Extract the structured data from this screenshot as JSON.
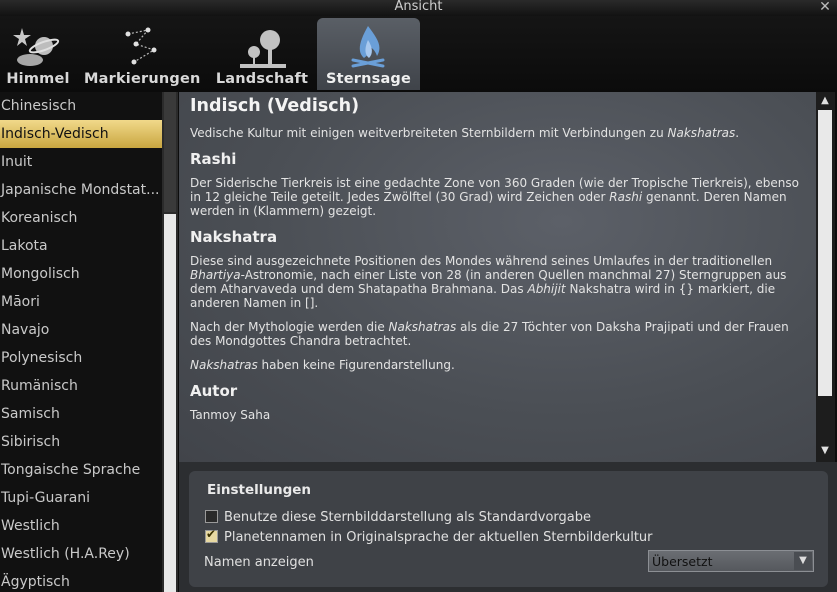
{
  "window": {
    "title": "Ansicht",
    "close_glyph": "✕"
  },
  "tabs": [
    {
      "label": "Himmel",
      "icon": "planets-icon",
      "active": false
    },
    {
      "label": "Markierungen",
      "icon": "constellation-markers-icon",
      "active": false
    },
    {
      "label": "Landschaft",
      "icon": "landscape-trees-icon",
      "active": false
    },
    {
      "label": "Sternsage",
      "icon": "campfire-icon",
      "active": true
    }
  ],
  "sidebar": {
    "items": [
      {
        "label": "Chinesisch"
      },
      {
        "label": "Indisch-Vedisch",
        "selected": true
      },
      {
        "label": "Inuit"
      },
      {
        "label": "Japanische Mondstat..."
      },
      {
        "label": "Koreanisch"
      },
      {
        "label": "Lakota"
      },
      {
        "label": "Mongolisch"
      },
      {
        "label": "Māori"
      },
      {
        "label": "Navajo"
      },
      {
        "label": "Polynesisch"
      },
      {
        "label": "Rumänisch"
      },
      {
        "label": "Samisch"
      },
      {
        "label": "Sibirisch"
      },
      {
        "label": "Tongaische Sprache"
      },
      {
        "label": "Tupi-Guarani"
      },
      {
        "label": "Westlich"
      },
      {
        "label": "Westlich (H.A.Rey)"
      },
      {
        "label": "Ägyptisch"
      }
    ]
  },
  "description": {
    "title": "Indisch (Vedisch)",
    "intro_before": "Vedische Kultur mit einigen weitverbreiteten Sternbildern mit Verbindungen zu ",
    "intro_em": "Nakshatras",
    "intro_after": ".",
    "rashi_heading": "Rashi",
    "rashi_p_before": "Der Siderische Tierkreis ist eine gedachte Zone von 360 Graden (wie der Tropische Tierkreis), ebenso in 12 gleiche Teile geteilt. Jedes Zwölftel (30 Grad) wird Zeichen oder ",
    "rashi_p_em": "Rashi",
    "rashi_p_after": " genannt. Deren Namen werden in (Klammern) gezeigt.",
    "nak_heading": "Nakshatra",
    "nak_p1_before": "Diese sind ausgezeichnete Positionen des Mondes während seines Umlaufes in der traditionellen ",
    "nak_p1_em1": "Bhartiya",
    "nak_p1_mid": "-Astronomie, nach einer Liste von 28 (in anderen Quellen manchmal 27) Sterngruppen aus dem Atharvaveda und dem Shatapatha Brahmana. Das ",
    "nak_p1_em2": "Abhijit",
    "nak_p1_after": " Nakshatra wird in {} markiert, die anderen Namen in [].",
    "nak_p2_before": "Nach der Mythologie werden die ",
    "nak_p2_em": "Nakshatras",
    "nak_p2_after": " als die 27 Töchter von Daksha Prajipati und der Frauen des Mondgottes Chandra betrachtet.",
    "nak_p3_em": "Nakshatras",
    "nak_p3_after": " haben keine Figurendarstellung.",
    "author_heading": "Autor",
    "author_name": "Tanmoy Saha"
  },
  "settings": {
    "title": "Einstellungen",
    "default_checkbox": {
      "label": "Benutze diese Sternbilddarstellung als Standardvorgabe",
      "checked": false
    },
    "native_names_checkbox": {
      "label": "Planetennamen in Originalsprache der aktuellen Sternbilderkultur",
      "checked": true
    },
    "names_label": "Namen anzeigen",
    "names_select_value": "Übersetzt"
  },
  "colors": {
    "selected_item": "#d9b95a",
    "active_tab": "#50555c",
    "accent_blue": "#6a9fd8"
  }
}
